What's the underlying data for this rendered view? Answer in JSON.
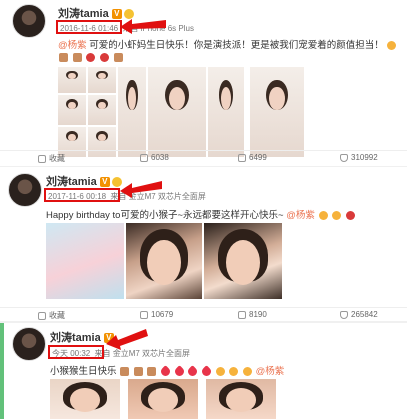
{
  "accent": "#e01010",
  "posts": [
    {
      "author": "刘涛tamia",
      "time": "2016-11-6 01:46",
      "source_prefix": "来自",
      "source": "iPhone 6s Plus",
      "text": "可爱的小虾妈生日快乐！你是演技派！更是被我们宠爱着的颜值担当！",
      "mention": "@杨紫",
      "actions": {
        "favorite": "收藏",
        "repost": "6038",
        "comment": "6499",
        "like": "310992"
      }
    },
    {
      "author": "刘涛tamia",
      "time": "2017-11-6 00:18",
      "source_prefix": "来自",
      "source": "金立M7 双芯片全面屏",
      "text": "Happy birthday to可爱的小猴子~永远都要这样开心快乐~",
      "mention": "@杨紫",
      "actions": {
        "favorite": "收藏",
        "repost": "10679",
        "comment": "8190",
        "like": "265842"
      }
    },
    {
      "author": "刘涛tamia",
      "time": "今天 00:32",
      "source_prefix": "来自",
      "source": "金立M7 双芯片全面屏",
      "text": "小猴猴生日快乐",
      "mention": "@杨紫"
    }
  ]
}
